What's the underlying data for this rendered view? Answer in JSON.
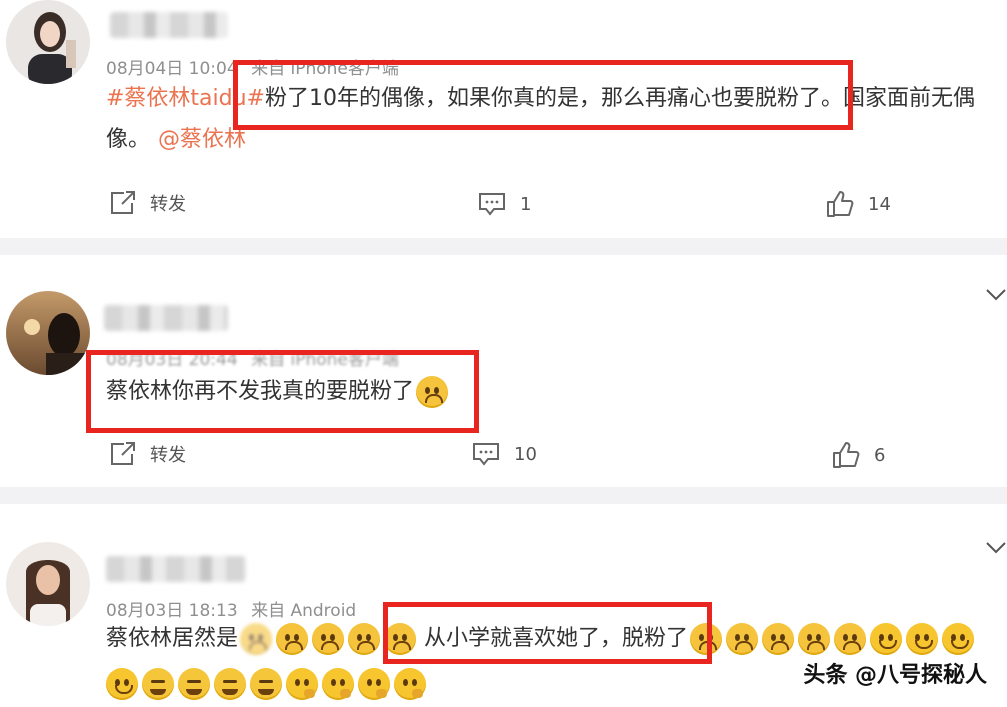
{
  "posts": [
    {
      "timestamp": "08月04日 10:04",
      "source": "来自 iPhone客户端",
      "hashtag": "#蔡依林taidu#",
      "text_line1": "粉了10年的偶像，如果你真的是，那么再痛心也要脱粉了。国家面前无偶",
      "text_line2": "像。",
      "mention": "@蔡依林",
      "repost_label": "转发",
      "comment_count": "1",
      "like_count": "14"
    },
    {
      "timestamp": "08月03日 20:44",
      "source": "来自 iPhone客户端",
      "text": "蔡依林你再不发我真的要脱粉了",
      "repost_label": "转发",
      "comment_count": "10",
      "like_count": "6"
    },
    {
      "timestamp": "08月03日 18:13",
      "source": "来自 Android",
      "text_start": "蔡依林居然是",
      "text_highlight": "从小学就喜欢她了，脱粉了"
    }
  ],
  "watermark": "头条 @八号探秘人",
  "colors": {
    "highlight_box": "#e8251f",
    "link": "#eb7350",
    "separator": "#f2f2f4"
  },
  "icons": [
    "chevron-down-icon",
    "repost-icon",
    "comment-icon",
    "like-icon",
    "emoji-cry-icon",
    "emoji-smile-icon",
    "emoji-squint-icon",
    "emoji-think-icon"
  ]
}
